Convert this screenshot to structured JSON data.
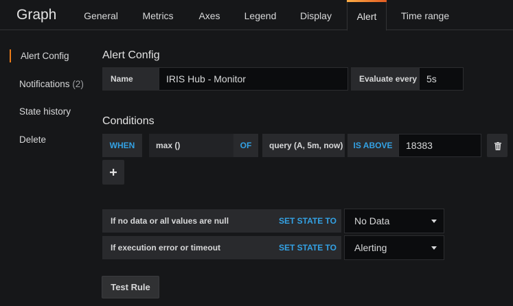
{
  "app": {
    "title": "Graph"
  },
  "tabs": [
    {
      "label": "General"
    },
    {
      "label": "Metrics"
    },
    {
      "label": "Axes"
    },
    {
      "label": "Legend"
    },
    {
      "label": "Display"
    },
    {
      "label": "Alert",
      "active": true
    },
    {
      "label": "Time range"
    }
  ],
  "sidebar": {
    "items": [
      {
        "label": "Alert Config",
        "active": true
      },
      {
        "label": "Notifications",
        "count": "(2)"
      },
      {
        "label": "State history"
      },
      {
        "label": "Delete"
      }
    ]
  },
  "alert_config": {
    "title": "Alert Config",
    "name_label": "Name",
    "name_value": "IRIS Hub - Monitor",
    "evaluate_label": "Evaluate every",
    "evaluate_value": "5s"
  },
  "conditions": {
    "title": "Conditions",
    "when_label": "WHEN",
    "reducer": "max ()",
    "of_label": "OF",
    "query": "query (A, 5m, now)",
    "evaluator": "IS ABOVE",
    "threshold": "18383",
    "add_icon": "plus-icon",
    "delete_icon": "trash-icon"
  },
  "no_data": {
    "label": "If no data or all values are null",
    "set_state_label": "SET STATE TO",
    "value": "No Data"
  },
  "exec_error": {
    "label": "If execution error or timeout",
    "set_state_label": "SET STATE TO",
    "value": "Alerting"
  },
  "test_rule": {
    "label": "Test Rule"
  },
  "colors": {
    "accent": "#eb7b18",
    "keyword": "#33a2e5",
    "background": "#161719"
  }
}
